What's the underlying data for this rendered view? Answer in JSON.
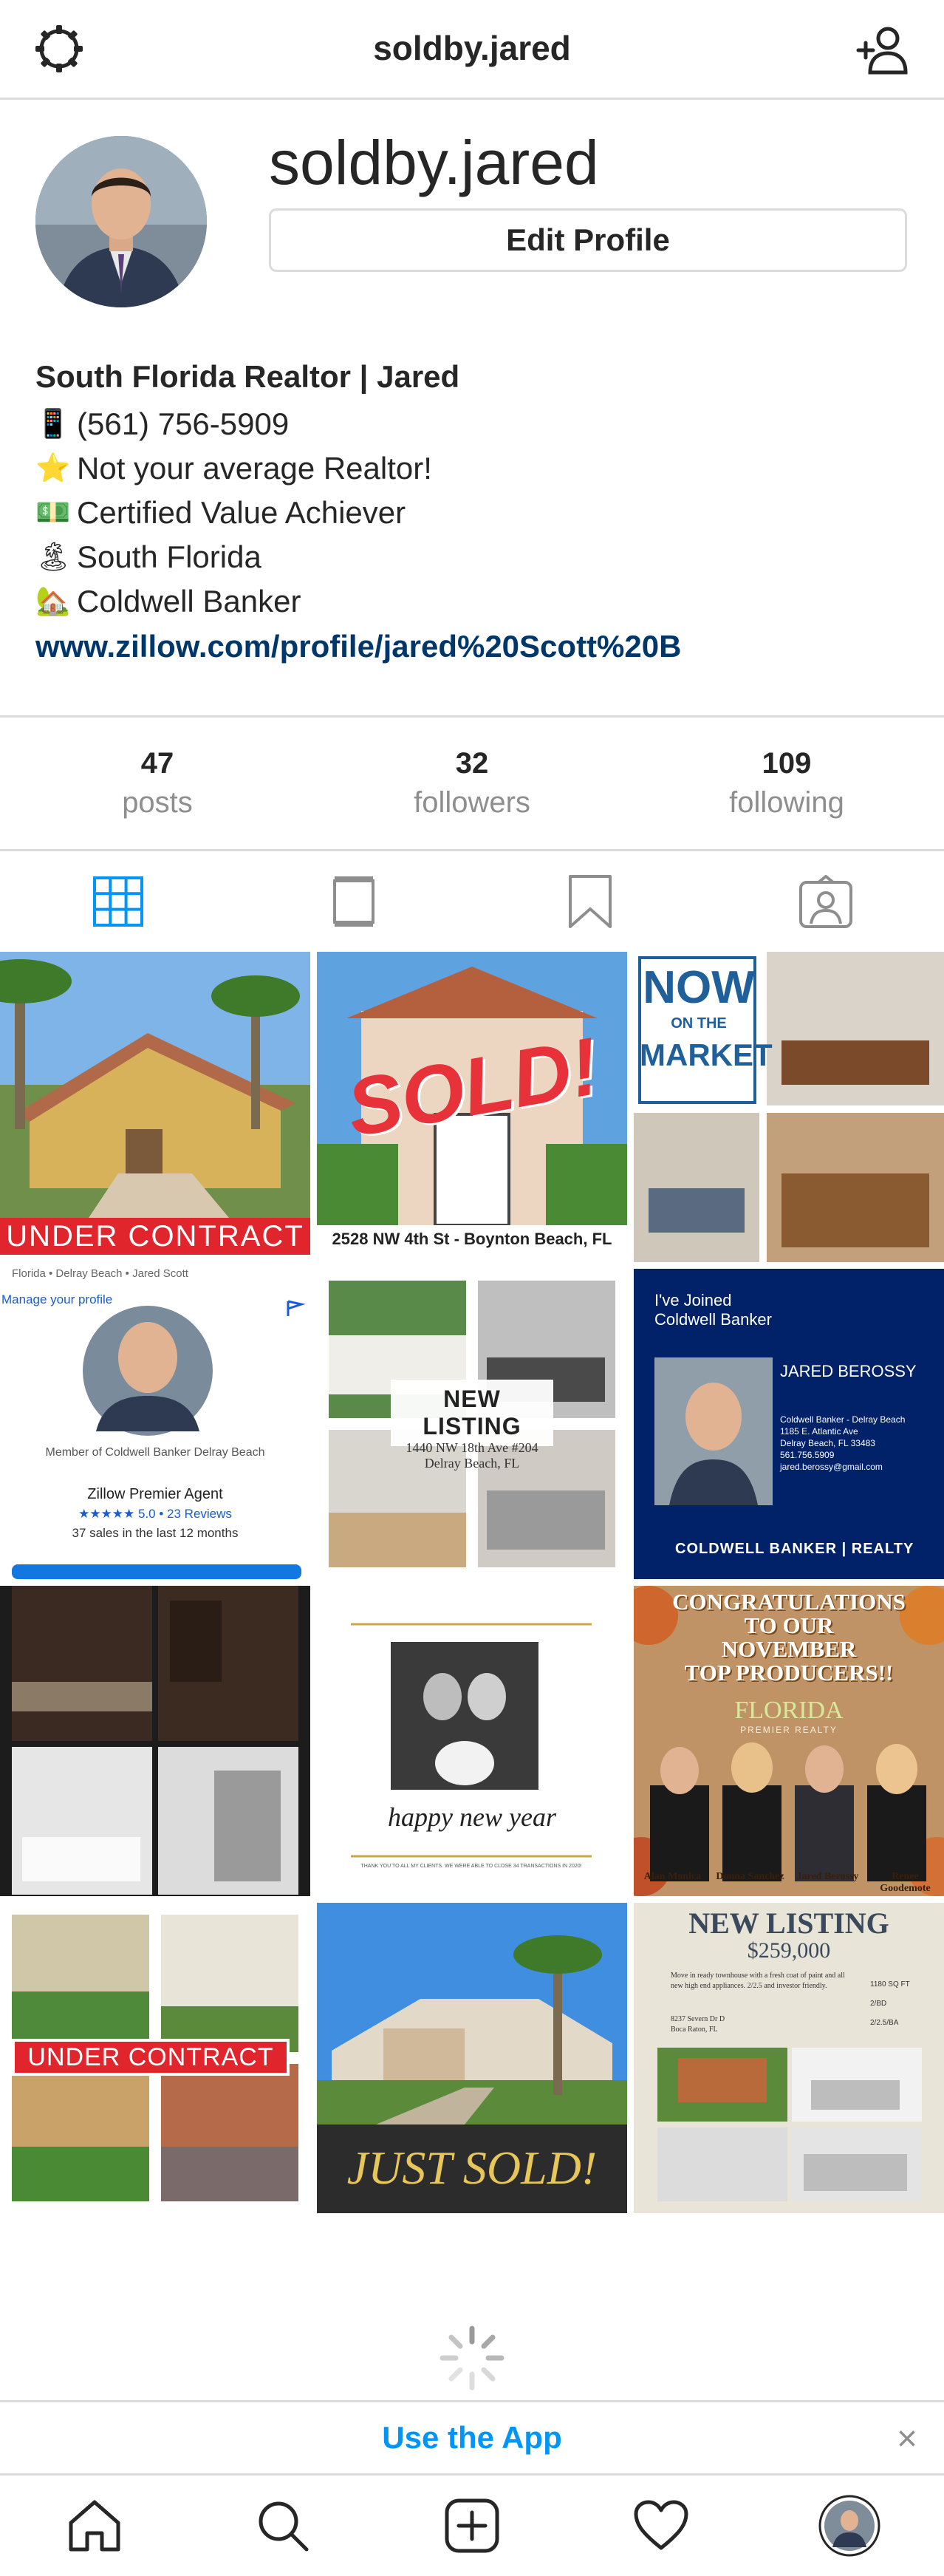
{
  "topnav": {
    "handle": "soldby.jared",
    "settings_icon": "gear-icon",
    "add_user_icon": "add-person-icon"
  },
  "profile": {
    "username": "soldby.jared",
    "edit_button": "Edit Profile"
  },
  "bio": {
    "name": "South Florida Realtor | Jared",
    "lines": [
      {
        "emoji": "📱",
        "text": "(561) 756-5909"
      },
      {
        "emoji": "⭐",
        "text": "Not your average Realtor!"
      },
      {
        "emoji": "💵",
        "text": "Certified Value Achiever"
      },
      {
        "emoji": "🏝",
        "text": "South Florida"
      },
      {
        "emoji": "🏡",
        "text": "Coldwell Banker"
      }
    ],
    "link": "www.zillow.com/profile/jared%20Scott%20B"
  },
  "stats": [
    {
      "value": "47",
      "label": "posts"
    },
    {
      "value": "32",
      "label": "followers"
    },
    {
      "value": "109",
      "label": "following"
    }
  ],
  "tabs": [
    "grid-icon",
    "feed-icon",
    "saved-icon",
    "tagged-icon"
  ],
  "posts": {
    "p1": {
      "banner": "UNDER CONTRACT"
    },
    "p2": {
      "overlay": "SOLD!",
      "caption": "2528 NW 4th St - Boynton Beach, FL"
    },
    "p3": {
      "line1": "NOW",
      "line2": "ON THE",
      "line3": "MARKET"
    },
    "p4": {
      "top": "Florida • Delray Beach • Jared Scott",
      "manage": "Manage your profile",
      "member": "Member of Coldwell Banker Delray Beach",
      "premier": "Zillow Premier Agent",
      "rating": "★★★★★ 5.0 • 23 Reviews",
      "sales": "37 sales in the last 12 months"
    },
    "p5": {
      "title": "NEW LISTING",
      "addr1": "1440 NW 18th Ave #204",
      "addr2": "Delray Beach, FL"
    },
    "p6": {
      "joined1": "I've Joined",
      "joined2": "Coldwell Banker",
      "agent": "JARED BEROSSY",
      "info1": "Coldwell Banker - Delray Beach",
      "info2": "1185 E. Atlantic Ave",
      "info3": "Delray Beach, FL 33483",
      "info4": "561.756.5909",
      "info5": "jared.berossy@gmail.com",
      "brand": "COLDWELL BANKER | REALTY"
    },
    "p8": {
      "text": "happy new year",
      "small": "THANK YOU TO ALL MY CLIENTS. WE WERE ABLE TO CLOSE 34 TRANSACTIONS IN 2020!"
    },
    "p9": {
      "line1": "CONGRATULATIONS",
      "line2": "TO OUR",
      "line3": "NOVEMBER",
      "line4": "TOP PRODUCERS!!",
      "brand": "FLORIDA",
      "brand_sub": "PREMIER REALTY",
      "names": [
        "Alan Monica",
        "Donna Sanchez",
        "Jared Berossy",
        "Renee Goodemote"
      ]
    },
    "p10": {
      "banner": "UNDER CONTRACT"
    },
    "p11": {
      "text": "JUST SOLD!"
    },
    "p12": {
      "title": "NEW LISTING",
      "price": "$259,000",
      "desc": "Move in ready townhouse with a fresh coat of paint and all new high end appliances. 2/2.5 and investor friendly.",
      "addr1": "8237 Severn Dr D",
      "addr2": "Boca Raton, FL",
      "sqft": "1180 SQ FT",
      "beds": "2/BD",
      "baths": "2/2.5/BA"
    }
  },
  "appbar": {
    "cta": "Use the App",
    "close": "×"
  },
  "bottomnav": [
    "home-icon",
    "search-icon",
    "new-post-icon",
    "activity-icon",
    "profile-avatar"
  ],
  "colors": {
    "accent": "#0095f6",
    "link": "#00376b",
    "banner_red": "#e1252c",
    "cb_blue": "#012169"
  }
}
